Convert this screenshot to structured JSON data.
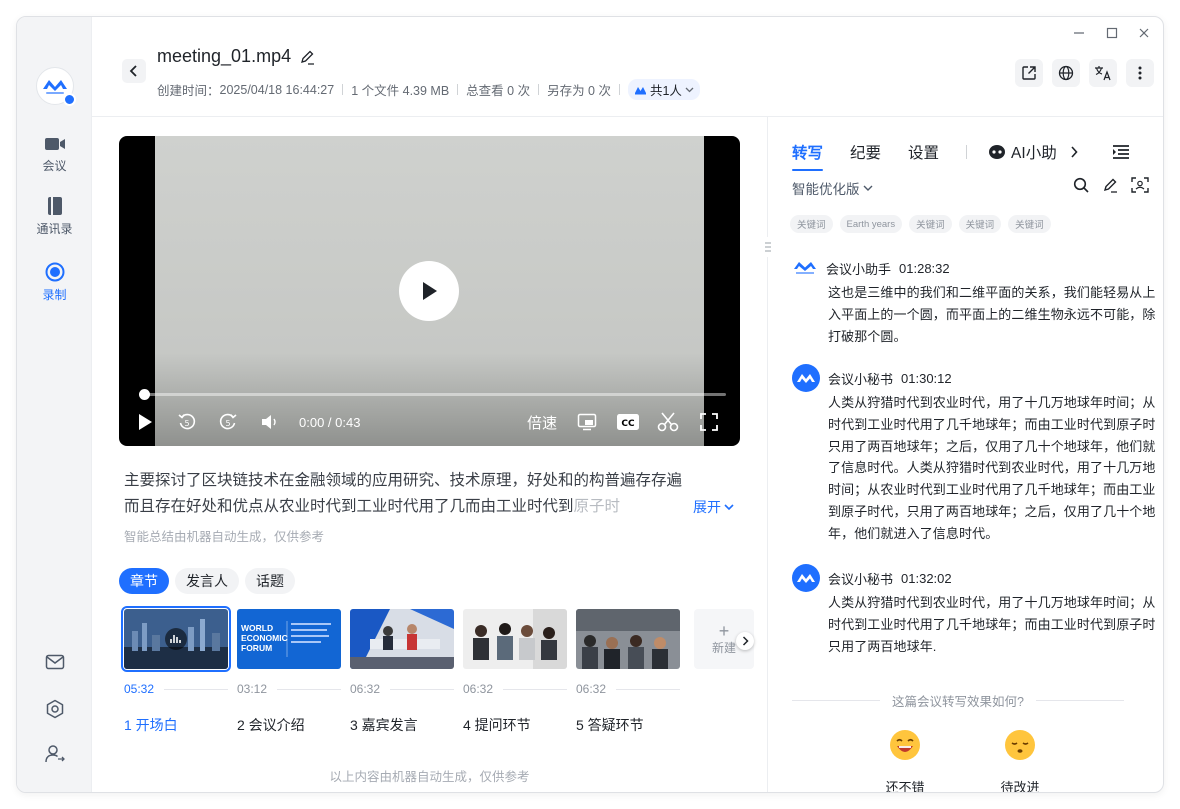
{
  "nav": {
    "items": [
      {
        "label": "会议",
        "icon": "video-camera-icon"
      },
      {
        "label": "通讯录",
        "icon": "contacts-book-icon"
      },
      {
        "label": "录制",
        "icon": "record-icon",
        "active": true
      }
    ],
    "bottom_icons": [
      "mail-icon",
      "settings-gear-icon",
      "user-switch-icon"
    ]
  },
  "header": {
    "title": "meeting_01.mp4",
    "created_label": "创建时间：",
    "created_time": "2025/04/18 16:44:27",
    "files": "1 个文件 4.39 MB",
    "views": "总查看 0 次",
    "saved": "另存为 0 次",
    "share": "共1人"
  },
  "video": {
    "time": "0:00 / 0:43",
    "speed_label": "倍速",
    "progress": 0
  },
  "summary": {
    "line1": "主要探讨了区块链技术在金融领域的应用研究、技术原理，好处和的构普遍存存遍",
    "line2": "而且存在好处和优点从农业时代到工业时代用了几而由工业时代到",
    "line2_fade": "原子时",
    "expand": "展开",
    "note": "智能总结由机器自动生成，仅供参考"
  },
  "filters": [
    "章节",
    "发言人",
    "话题"
  ],
  "chapters": [
    {
      "time": "05:32",
      "title": "1 开场白"
    },
    {
      "time": "03:12",
      "title": "2 会议介绍",
      "thumb_text": "WORLD ECONOMIC FORUM"
    },
    {
      "time": "06:32",
      "title": "3 嘉宾发言"
    },
    {
      "time": "06:32",
      "title": "4 提问环节"
    },
    {
      "time": "06:32",
      "title": "5 答疑环节"
    }
  ],
  "new_chapter": "新建",
  "footer_note": "以上内容由机器自动生成，仅供参考",
  "panel": {
    "tabs": [
      "转写",
      "纪要",
      "设置"
    ],
    "ai_tab": "AI小助",
    "version": "智能优化版",
    "keywords": [
      "关键词",
      "Earth years",
      "关键词",
      "关键词",
      "关键词"
    ],
    "transcripts": [
      {
        "speaker": "会议小助手",
        "time": "01:28:32",
        "text": "这也是三维中的我们和二维平面的关系，我们能轻易从上入平面上的一个圆，而平面上的二维生物永远不可能，除打破那个圆。"
      },
      {
        "speaker": "会议小秘书",
        "time": "01:30:12",
        "text": "人类从狩猎时代到农业时代，用了十几万地球年时间；从时代到工业时代用了几千地球年；而由工业时代到原子时只用了两百地球年；之后，仅用了几十个地球年，他们就了信息时代。人类从狩猎时代到农业时代，用了十几万地时间；从农业时代到工业时代用了几千地球年；而由工业到原子时代，只用了两百地球年；之后，仅用了几十个地年，他们就进入了信息时代。"
      },
      {
        "speaker": "会议小秘书",
        "time": "01:32:02",
        "text": "人类从狩猎时代到农业时代，用了十几万地球年时间；从时代到工业时代用了几千地球年；而由工业时代到原子时只用了两百地球年."
      }
    ],
    "feedback_question": "这篇会议转写效果如何?",
    "feedback_good": "还不错",
    "feedback_bad": "待改进"
  },
  "colors": {
    "accent": "#1f6fff"
  }
}
